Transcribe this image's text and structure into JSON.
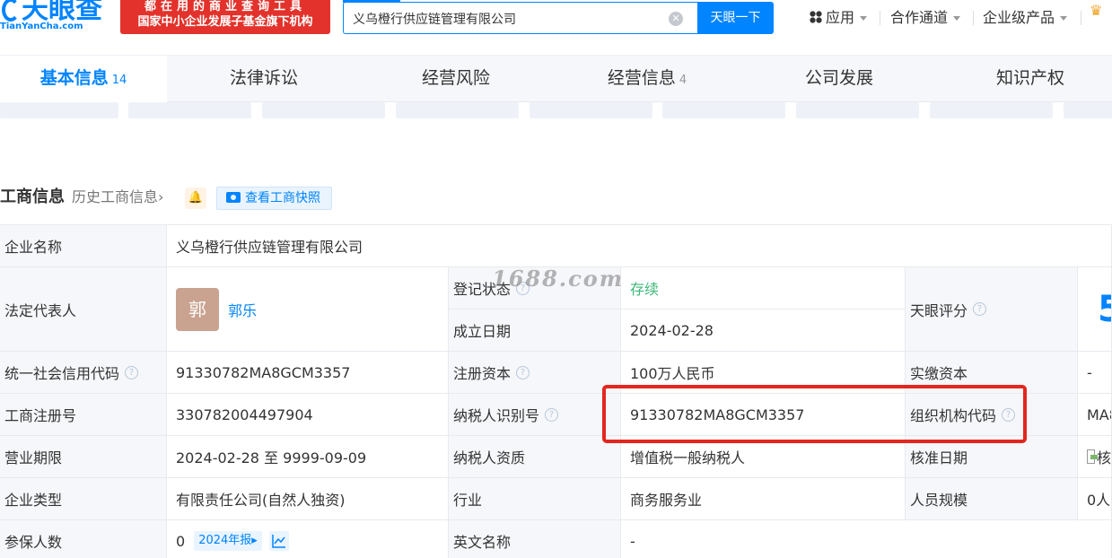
{
  "header": {
    "logo_main": "天眼查",
    "logo_sub": "TianYanCha.com",
    "promo_line1": "都在用的商业查询工具",
    "promo_line2": "国家中小企业发展子基金旗下机构",
    "search_value": "义乌橙行供应链管理有限公司",
    "search_button": "天眼一下",
    "nav": {
      "apps": "应用",
      "partner": "合作通道",
      "enterprise": "企业级产品"
    }
  },
  "tabs": [
    {
      "label": "基本信息",
      "count": "14"
    },
    {
      "label": "法律诉讼",
      "count": ""
    },
    {
      "label": "经营风险",
      "count": ""
    },
    {
      "label": "经营信息",
      "count": "4"
    },
    {
      "label": "公司发展",
      "count": ""
    },
    {
      "label": "知识产权",
      "count": ""
    }
  ],
  "section": {
    "title": "工商信息",
    "history_link": "历史工商信息",
    "snapshot_button": "查看工商快照"
  },
  "info": {
    "company_name_label": "企业名称",
    "company_name": "义乌橙行供应链管理有限公司",
    "legal_rep_label": "法定代表人",
    "legal_rep_avatar": "郭",
    "legal_rep_name": "郭乐",
    "reg_status_label": "登记状态",
    "reg_status": "存续",
    "founded_label": "成立日期",
    "founded": "2024-02-28",
    "score_label": "天眼评分",
    "score_partial": "5",
    "credit_code_label": "统一社会信用代码",
    "credit_code": "91330782MA8GCM3357",
    "reg_capital_label": "注册资本",
    "reg_capital": "100万人民币",
    "paid_capital_label": "实缴资本",
    "paid_capital": "-",
    "reg_no_label": "工商注册号",
    "reg_no": "330782004497904",
    "taxpayer_id_label": "纳税人识别号",
    "taxpayer_id": "91330782MA8GCM3357",
    "org_code_label": "组织机构代码",
    "org_code_partial": "MA8",
    "term_label": "营业期限",
    "term": "2024-02-28 至 9999-09-09",
    "taxpayer_type_label": "纳税人资质",
    "taxpayer_type": "增值税一般纳税人",
    "approve_label": "核准日期",
    "approve_partial": "核",
    "company_type_label": "企业类型",
    "company_type": "有限责任公司(自然人独资)",
    "industry_label": "行业",
    "industry": "商务服务业",
    "staff_label": "人员规模",
    "staff_partial": "0人",
    "insured_label": "参保人数",
    "insured": "0",
    "report_link": "2024年报",
    "english_name_label": "英文名称",
    "english_name": "-"
  },
  "watermark": "1688.com"
}
